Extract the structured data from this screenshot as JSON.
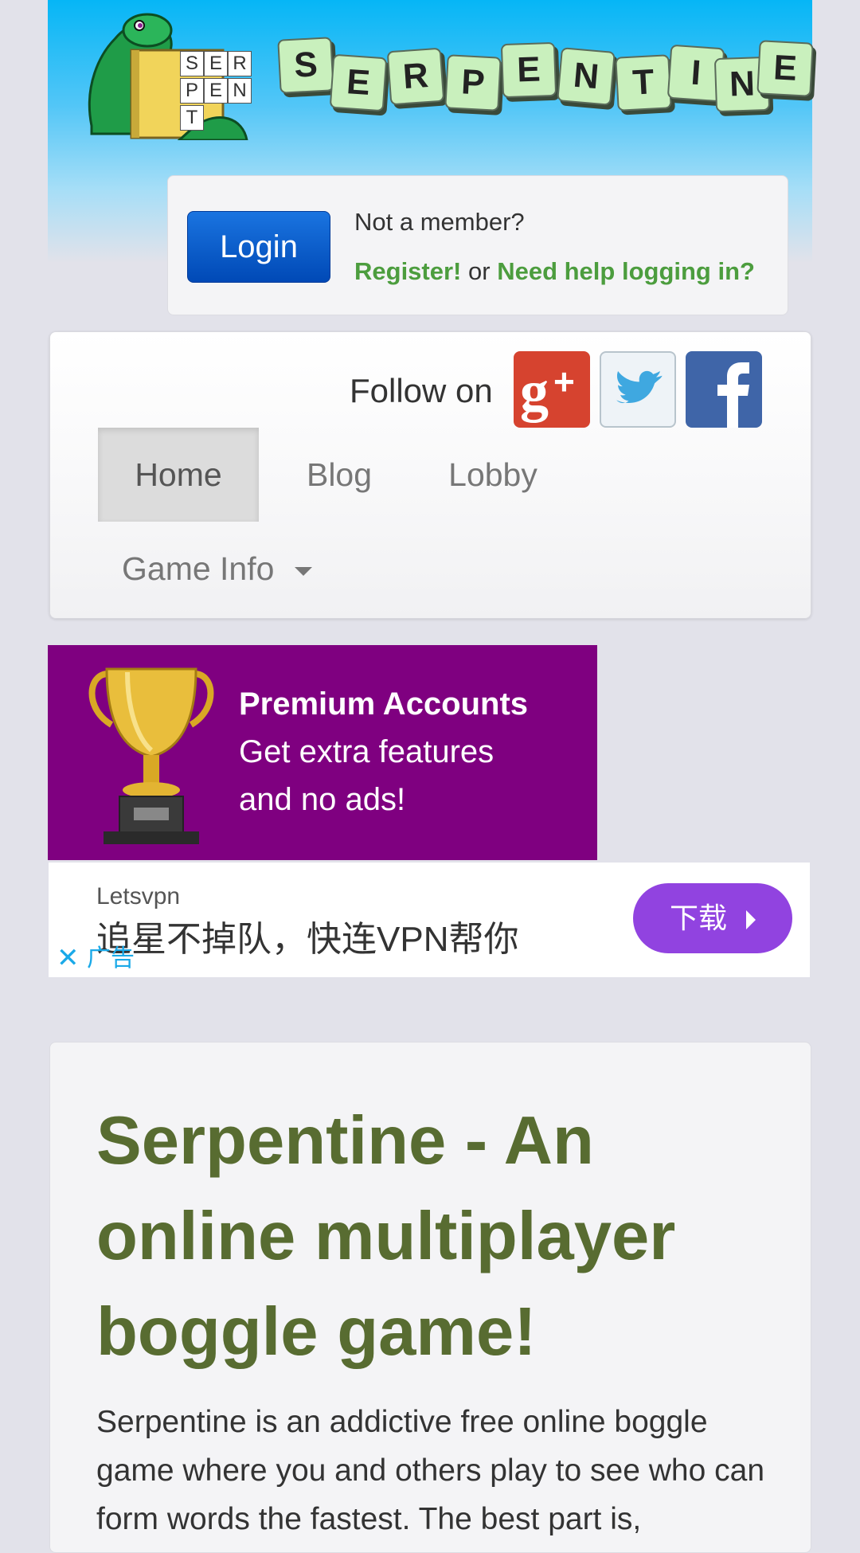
{
  "header": {
    "logo_tiles": [
      "S",
      "E",
      "R",
      "P",
      "E",
      "N",
      "T",
      "I",
      "N",
      "E"
    ],
    "snake_board_letters": [
      "S",
      "E",
      "R",
      "P",
      "E",
      "N",
      "T"
    ]
  },
  "login": {
    "button_label": "Login",
    "not_member": "Not a member?",
    "register_link": "Register!",
    "or_text": "or",
    "help_link": "Need help logging in?"
  },
  "social": {
    "follow_label": "Follow on",
    "icons": [
      "google-plus-icon",
      "twitter-icon",
      "facebook-icon"
    ],
    "colors": {
      "google_plus": "#d6432f",
      "twitter": "#3fa8e0",
      "facebook": "#3f65a8"
    }
  },
  "nav": {
    "items": [
      {
        "label": "Home",
        "active": true
      },
      {
        "label": "Blog",
        "active": false
      },
      {
        "label": "Lobby",
        "active": false
      },
      {
        "label": "Game Info",
        "active": false,
        "dropdown": true
      }
    ]
  },
  "promo": {
    "title": "Premium Accounts",
    "line1": "Get extra features",
    "line2": "and no ads!",
    "background": "#7f0080"
  },
  "ad": {
    "brand": "Letsvpn",
    "text": "追星不掉队，快连VPN帮你",
    "label": "广告",
    "button": "下载",
    "accent": "#9143e0"
  },
  "content": {
    "title": "Serpentine - An online multiplayer boggle game!",
    "intro": "Serpentine is an addictive free online boggle game where you and others play to see who can form words the fastest. The best part is,",
    "title_color": "#586c31"
  }
}
